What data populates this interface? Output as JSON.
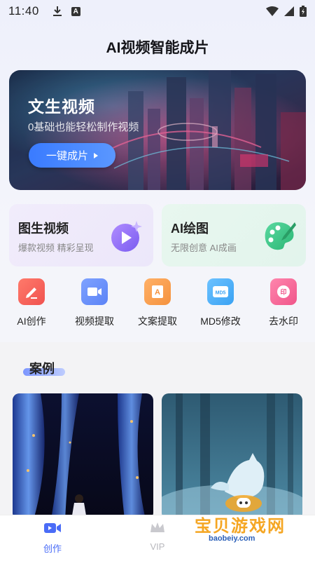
{
  "status_bar": {
    "time": "11:40"
  },
  "header": {
    "title": "AI视频智能成片"
  },
  "hero": {
    "title": "文生视频",
    "subtitle": "0基础也能轻松制作视频",
    "button_label": "一键成片"
  },
  "features": [
    {
      "title": "图生视频",
      "subtitle": "爆款视频 精彩呈现",
      "icon": "play-bubble-icon",
      "color": "#8b6cf0"
    },
    {
      "title": "AI绘图",
      "subtitle": "无限创意 AI成画",
      "icon": "palette-icon",
      "color": "#34c17a"
    }
  ],
  "tools": [
    {
      "label": "AI创作",
      "icon": "pen-icon",
      "color": "#f0524f"
    },
    {
      "label": "视频提取",
      "icon": "video-camera-icon",
      "color": "#5b83f6"
    },
    {
      "label": "文案提取",
      "icon": "document-a-icon",
      "color": "#f5923e"
    },
    {
      "label": "MD5修改",
      "icon": "md5-icon",
      "color": "#3aa2f3"
    },
    {
      "label": "去水印",
      "icon": "stamp-icon",
      "color": "#f0558a"
    }
  ],
  "cases": {
    "title": "案例"
  },
  "bottom_nav": [
    {
      "label": "创作",
      "icon": "video-camera-icon",
      "active": true
    },
    {
      "label": "VIP",
      "icon": "crown-icon",
      "active": false
    }
  ],
  "watermark": {
    "text": "宝贝游戏网",
    "url": "baobeiy.com"
  },
  "colors": {
    "accent": "#4a6cf7",
    "background": "#f4f5fb"
  }
}
